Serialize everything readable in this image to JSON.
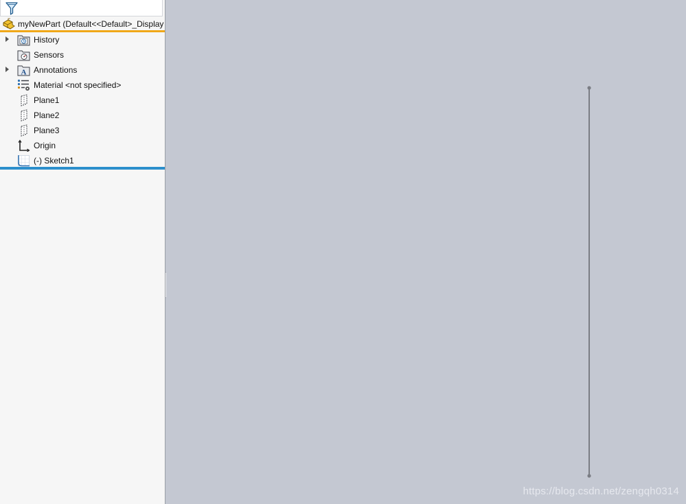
{
  "feature_tree": {
    "filter_icon": "filter-funnel-icon",
    "root": {
      "label": "myNewPart  (Default<<Default>_Display",
      "icon": "part-icon"
    },
    "items": [
      {
        "label": "History",
        "icon": "history-folder-icon",
        "expandable": true
      },
      {
        "label": "Sensors",
        "icon": "sensors-folder-icon",
        "expandable": false
      },
      {
        "label": "Annotations",
        "icon": "annotations-folder-icon",
        "expandable": true
      },
      {
        "label": "Material <not specified>",
        "icon": "material-icon",
        "expandable": false
      },
      {
        "label": "Plane1",
        "icon": "plane-icon",
        "expandable": false
      },
      {
        "label": "Plane2",
        "icon": "plane-icon",
        "expandable": false
      },
      {
        "label": "Plane3",
        "icon": "plane-icon",
        "expandable": false
      },
      {
        "label": "Origin",
        "icon": "origin-icon",
        "expandable": false
      },
      {
        "label": "(-) Sketch1",
        "icon": "sketch-icon",
        "expandable": false
      }
    ]
  },
  "viewport": {
    "background": "#c4c8d2",
    "sketch_line_color": "#7a7d84",
    "watermark": "https://blog.csdn.net/zengqh0314"
  },
  "colors": {
    "root_underline": "#f0a818",
    "rollback_bar": "#2c8fcc"
  }
}
